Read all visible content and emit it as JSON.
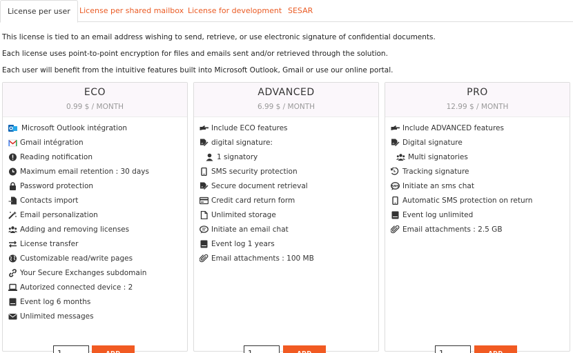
{
  "tabs": [
    {
      "label": "License per user",
      "active": true
    },
    {
      "label": "License per shared mailbox",
      "active": false
    },
    {
      "label": "License for development",
      "active": false
    },
    {
      "label": "SESAR",
      "active": false
    }
  ],
  "intro": [
    "This license is tied to an email address wishing to send, retrieve, or use electronic signature of confidential documents.",
    "Each license uses point-to-point encryption for files and emails sent and/or retrieved through the solution.",
    "Each user will benefit from the intuitive features built into Microsoft Outlook, Gmail or use our online portal."
  ],
  "colors": {
    "accent": "#ea5b24",
    "button": "#f15a22",
    "card_header_bg": "#fbf7fb"
  },
  "plans": [
    {
      "name": "ECO",
      "price": "0.99 $ / MONTH",
      "features": [
        {
          "icon": "outlook-icon",
          "text": "Microsoft Outlook intégration"
        },
        {
          "icon": "gmail-icon",
          "text": "Gmail intégration"
        },
        {
          "icon": "exclamation-icon",
          "text": "Reading notification"
        },
        {
          "icon": "clock-icon",
          "text": "Maximum email retention : 30 days"
        },
        {
          "icon": "lock-icon",
          "text": "Password protection"
        },
        {
          "icon": "file-import-icon",
          "text": "Contacts import"
        },
        {
          "icon": "magic-wand-icon",
          "text": "Email personalization"
        },
        {
          "icon": "users-icon",
          "text": "Adding and removing licenses"
        },
        {
          "icon": "exchange-icon",
          "text": "License transfer"
        },
        {
          "icon": "globe-icon",
          "text": "Customizable read/write pages"
        },
        {
          "icon": "link-icon",
          "text": "Your Secure Exchanges subdomain"
        },
        {
          "icon": "laptop-icon",
          "text": "Autorized connected device : 2"
        },
        {
          "icon": "server-icon",
          "text": "Event log 6 months"
        },
        {
          "icon": "envelope-icon",
          "text": "Unlimited messages"
        }
      ],
      "quantity": "1",
      "add_label": "ADD"
    },
    {
      "name": "ADVANCED",
      "price": "6.99 $ / MONTH",
      "features": [
        {
          "icon": "hand-point-right-icon",
          "text": "Include ECO features"
        },
        {
          "icon": "signature-icon",
          "text": "digital signature:"
        },
        {
          "icon": "user-icon",
          "text": "1 signatory",
          "indent": true
        },
        {
          "icon": "mobile-icon",
          "text": "SMS security protection"
        },
        {
          "icon": "signature-icon",
          "text": "Secure document retrieval"
        },
        {
          "icon": "credit-card-icon",
          "text": "Credit card return form"
        },
        {
          "icon": "file-icon",
          "text": "Unlimited storage"
        },
        {
          "icon": "chat-icon",
          "text": "Initiate an email chat"
        },
        {
          "icon": "server-icon",
          "text": "Event log 1 years"
        },
        {
          "icon": "paperclip-icon",
          "text": "Email attachments : 100 MB"
        }
      ],
      "quantity": "1",
      "add_label": "ADD"
    },
    {
      "name": "PRO",
      "price": "12.99 $ / MONTH",
      "features": [
        {
          "icon": "hand-point-right-icon",
          "text": "Include ADVANCED features"
        },
        {
          "icon": "signature-icon",
          "text": "Digital signature"
        },
        {
          "icon": "users-icon",
          "text": "Multi signatories",
          "indent": true
        },
        {
          "icon": "history-signature-icon",
          "text": "Tracking signature"
        },
        {
          "icon": "sms-chat-icon",
          "text": "Initiate an sms chat"
        },
        {
          "icon": "mobile-icon",
          "text": "Automatic SMS protection on return"
        },
        {
          "icon": "server-icon",
          "text": "Event log unlimited"
        },
        {
          "icon": "paperclip-icon",
          "text": "Email attachments : 2.5 GB"
        }
      ],
      "quantity": "1",
      "add_label": "ADD"
    }
  ]
}
